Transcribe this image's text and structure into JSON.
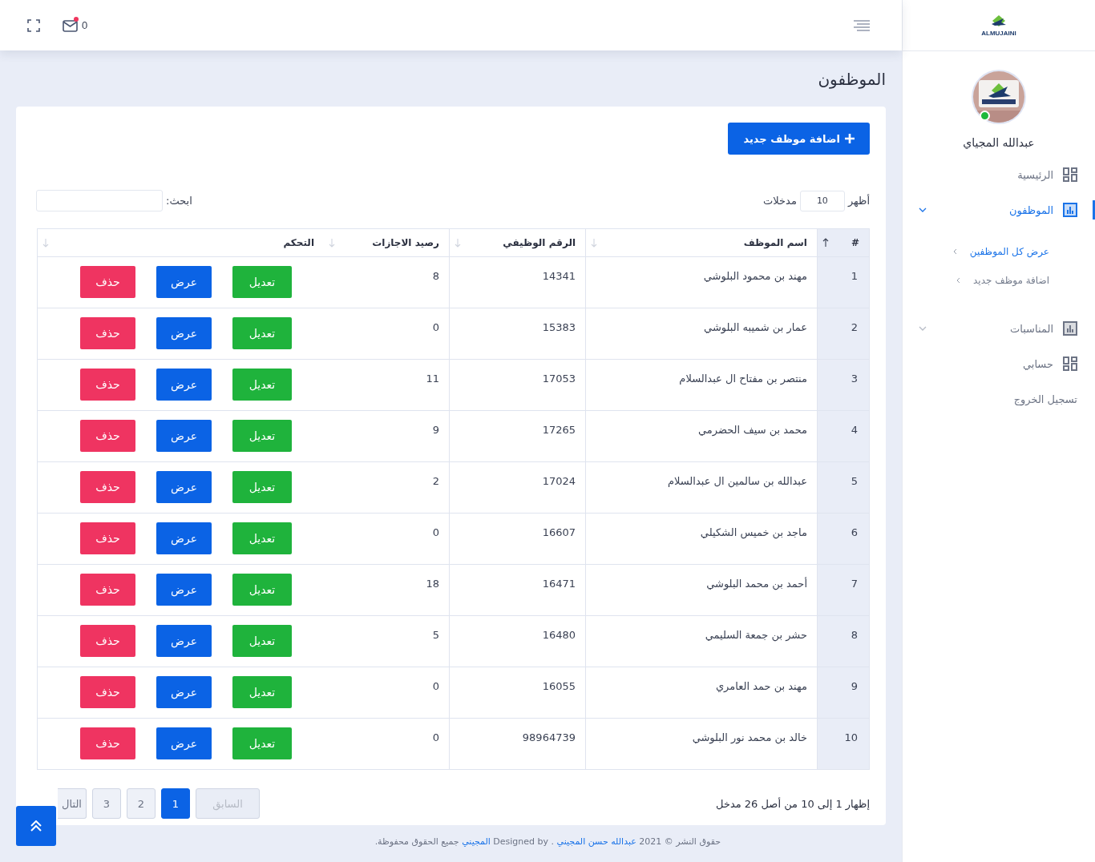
{
  "topbar": {
    "mail_count": "0",
    "mail_unread": true
  },
  "sidebar": {
    "logo_text": "ALMUJAINI",
    "user": {
      "name": "عبدالله المجياي",
      "online": true
    },
    "items": [
      {
        "label": "الرئيسية",
        "kind": "grid",
        "selected": false
      },
      {
        "label": "الموظفون",
        "kind": "chart",
        "selected": true,
        "expanded": true,
        "children": [
          {
            "label": "عرض كل الموظفين",
            "selected": true
          },
          {
            "label": "اضافة موظف جديد",
            "selected": false
          }
        ]
      },
      {
        "label": "المناسبات",
        "kind": "chart",
        "selected": false,
        "expanded": false
      },
      {
        "label": "حسابي",
        "kind": "grid",
        "selected": false
      },
      {
        "label": "تسجيل الخروج",
        "kind": "plain",
        "selected": false
      }
    ]
  },
  "page_title": "الموظفون",
  "add_button": "اضافة موظف جديد",
  "length_control": {
    "before": "أظهر",
    "value": "10",
    "after": "مدخلات"
  },
  "search": {
    "label": "ابحث:"
  },
  "table": {
    "columns": [
      {
        "label": "#",
        "sorted": true
      },
      {
        "label": "اسم الموظف",
        "sorted": false
      },
      {
        "label": "الرقم الوظيفي",
        "sorted": false
      },
      {
        "label": "رصيد الاجازات",
        "sorted": false
      },
      {
        "label": "التحكم",
        "sorted": false
      }
    ],
    "rows": [
      {
        "cells": [
          "1",
          "مهند بن محمود البلوشي",
          "14341",
          "8"
        ],
        "actions": [
          "تعديل",
          "عرض",
          "حذف"
        ]
      },
      {
        "cells": [
          "2",
          "عمار بن شميبه البلوشي",
          "15383",
          "0"
        ],
        "actions": [
          "تعديل",
          "عرض",
          "حذف"
        ]
      },
      {
        "cells": [
          "3",
          "منتصر بن مفتاح ال عبدالسلام",
          "17053",
          "11"
        ],
        "actions": [
          "تعديل",
          "عرض",
          "حذف"
        ]
      },
      {
        "cells": [
          "4",
          "محمد بن سيف الحضرمي",
          "17265",
          "9"
        ],
        "actions": [
          "تعديل",
          "عرض",
          "حذف"
        ]
      },
      {
        "cells": [
          "5",
          "عبدالله بن سالمين ال عبدالسلام",
          "17024",
          "2"
        ],
        "actions": [
          "تعديل",
          "عرض",
          "حذف"
        ]
      },
      {
        "cells": [
          "6",
          "ماجد بن خميس الشكيلي",
          "16607",
          "0"
        ],
        "actions": [
          "تعديل",
          "عرض",
          "حذف"
        ]
      },
      {
        "cells": [
          "7",
          "أحمد بن محمد البلوشي",
          "16471",
          "18"
        ],
        "actions": [
          "تعديل",
          "عرض",
          "حذف"
        ]
      },
      {
        "cells": [
          "8",
          "حشر بن جمعة السليمي",
          "16480",
          "5"
        ],
        "actions": [
          "تعديل",
          "عرض",
          "حذف"
        ]
      },
      {
        "cells": [
          "9",
          "مهند بن حمد العامري",
          "16055",
          "0"
        ],
        "actions": [
          "تعديل",
          "عرض",
          "حذف"
        ]
      },
      {
        "cells": [
          "10",
          "خالد بن محمد نور البلوشي",
          "98964739",
          "0"
        ],
        "actions": [
          "تعديل",
          "عرض",
          "حذف"
        ]
      }
    ]
  },
  "table_info": "إظهار 1 إلى 10 من أصل 26 مدخل",
  "pagination": [
    {
      "label": "السابق",
      "kind": "prev",
      "disabled": true,
      "selected": false
    },
    {
      "label": "1",
      "kind": "page",
      "disabled": false,
      "selected": true
    },
    {
      "label": "2",
      "kind": "page",
      "disabled": false,
      "selected": false
    },
    {
      "label": "3",
      "kind": "page",
      "disabled": false,
      "selected": false
    },
    {
      "label": "التال",
      "kind": "next",
      "disabled": false,
      "selected": false
    }
  ],
  "footer": [
    {
      "text": "حقوق النشر © 2021",
      "link": false
    },
    {
      "text": "عبدالله حسن المجيني",
      "link": true
    },
    {
      "text": ". Designed by",
      "link": false
    },
    {
      "text": "المجيني",
      "link": true
    },
    {
      "text": "جميع الحقوق محفوظة.",
      "link": false
    }
  ]
}
